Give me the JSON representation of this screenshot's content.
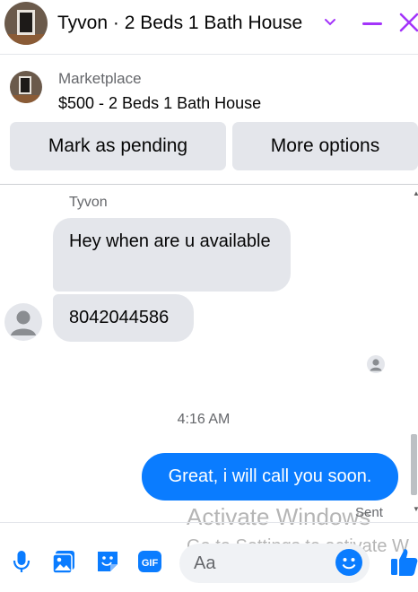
{
  "header": {
    "title": "Tyvon · 2 Beds 1 Bath House",
    "accent_color": "#a334fa"
  },
  "listing": {
    "label": "Marketplace",
    "title": "$500 - 2 Beds 1 Bath House",
    "buttons": [
      "Mark as pending",
      "More options"
    ]
  },
  "conversation": {
    "sender": "Tyvon",
    "incoming": [
      "Hey when are u available",
      "8042044586"
    ],
    "timestamp": "4:16 AM",
    "outgoing": "Great, i will call you soon.",
    "status": "Sent",
    "bubble_color": "#0a7cff"
  },
  "watermark": {
    "line1": "Activate Windows",
    "line2": "Go to Settings to activate W"
  },
  "composer": {
    "placeholder": "Aa",
    "icons": [
      "microphone-icon",
      "photo-icon",
      "sticker-icon",
      "gif-icon",
      "emoji-icon",
      "like-icon"
    ]
  }
}
